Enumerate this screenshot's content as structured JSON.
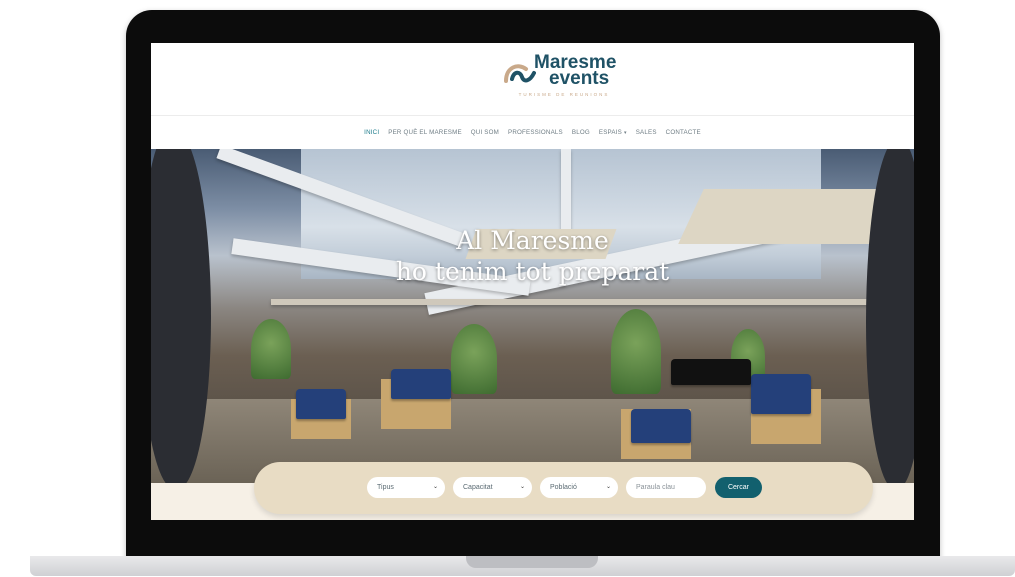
{
  "logo": {
    "line1": "Maresme",
    "line2": "events",
    "tagline": "TURISME DE REUNIONS",
    "colors": {
      "text": "#1f5266",
      "arc1": "#c9a98a",
      "arc2": "#1f5266"
    }
  },
  "nav": {
    "items": [
      {
        "label": "INICI",
        "active": true
      },
      {
        "label": "PER QUÈ EL MARESME"
      },
      {
        "label": "QUI SOM"
      },
      {
        "label": "PROFESSIONALS"
      },
      {
        "label": "BLOG"
      },
      {
        "label": "ESPAIS",
        "dropdown": true
      },
      {
        "label": "SALES"
      },
      {
        "label": "CONTACTE"
      }
    ],
    "active_color": "#1a7a8a"
  },
  "hero": {
    "title_line1": "Al Maresme",
    "title_line2": "ho tenim tot preparat"
  },
  "search": {
    "type_select": "Tipus",
    "capacity_select": "Capacitat",
    "town_select": "Població",
    "keyword_placeholder": "Paraula clau",
    "button_label": "Cercar",
    "button_color": "#12606e",
    "bar_color": "#e8dcc4"
  }
}
